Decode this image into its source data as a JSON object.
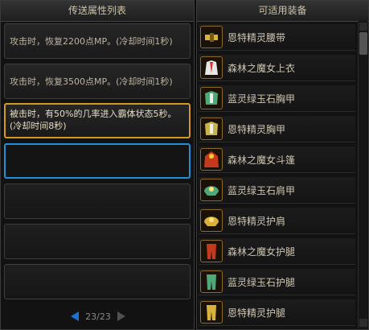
{
  "left_panel": {
    "title": "传送属性列表",
    "slots": [
      {
        "text": "攻击时，恢复2200点MP。(冷却时间1秒)",
        "state": "normal"
      },
      {
        "text": "攻击时，恢复3500点MP。(冷却时间1秒)",
        "state": "normal"
      },
      {
        "text": "被击时，有50%的几率进入霸体状态5秒。(冷却时间8秒)",
        "state": "selected"
      },
      {
        "text": "",
        "state": "focused"
      },
      {
        "text": "",
        "state": "empty"
      },
      {
        "text": "",
        "state": "empty"
      },
      {
        "text": "",
        "state": "empty"
      }
    ],
    "pager": {
      "text": "23/23"
    }
  },
  "right_panel": {
    "title": "可适用装备",
    "items": [
      {
        "name": "恩特精灵腰带",
        "icon": "belt-icon",
        "color": "#d8b23c"
      },
      {
        "name": "森林之魔女上衣",
        "icon": "robe-icon",
        "color": "#e7e7e7"
      },
      {
        "name": "蓝灵绿玉石胸甲",
        "icon": "chest-armor-icon",
        "color": "#4ea878"
      },
      {
        "name": "恩特精灵胸甲",
        "icon": "chest-armor-icon",
        "color": "#c8b24a"
      },
      {
        "name": "森林之魔女斗篷",
        "icon": "cloak-icon",
        "color": "#c33a1c"
      },
      {
        "name": "蓝灵绿玉石肩甲",
        "icon": "shoulder-icon",
        "color": "#4ea878"
      },
      {
        "name": "恩特精灵护肩",
        "icon": "shoulder-icon",
        "color": "#d8b23c"
      },
      {
        "name": "森林之魔女护腿",
        "icon": "legs-icon",
        "color": "#c33a1c"
      },
      {
        "name": "蓝灵绿玉石护腿",
        "icon": "legs-icon",
        "color": "#4ea878"
      },
      {
        "name": "恩特精灵护腿",
        "icon": "legs-icon",
        "color": "#d8b23c"
      }
    ]
  }
}
